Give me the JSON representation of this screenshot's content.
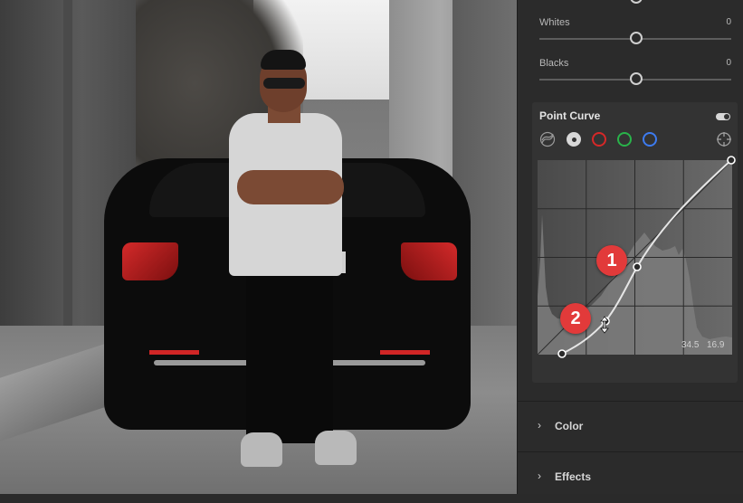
{
  "photo": {
    "icon": "photo-preview"
  },
  "sliders": [
    {
      "label": "Whites",
      "value": "0",
      "position": 0.5
    },
    {
      "label": "Blacks",
      "value": "0",
      "position": 0.5
    }
  ],
  "point_curve": {
    "title": "Point Curve",
    "enabled": true,
    "channels": [
      {
        "name": "parametric",
        "icon": "parametric-curve-icon"
      },
      {
        "name": "rgb",
        "color": "#ffffff"
      },
      {
        "name": "red",
        "color": "#d62828"
      },
      {
        "name": "green",
        "color": "#29b34a"
      },
      {
        "name": "blue",
        "color": "#3d7bf0"
      }
    ],
    "target_icon": "target-adjust-icon",
    "readout_input": "34.5",
    "readout_output": "16.9",
    "annotations": [
      "1",
      "2"
    ],
    "accent": "#e23a3a"
  },
  "sections": [
    {
      "label": "Color"
    },
    {
      "label": "Effects"
    }
  ]
}
